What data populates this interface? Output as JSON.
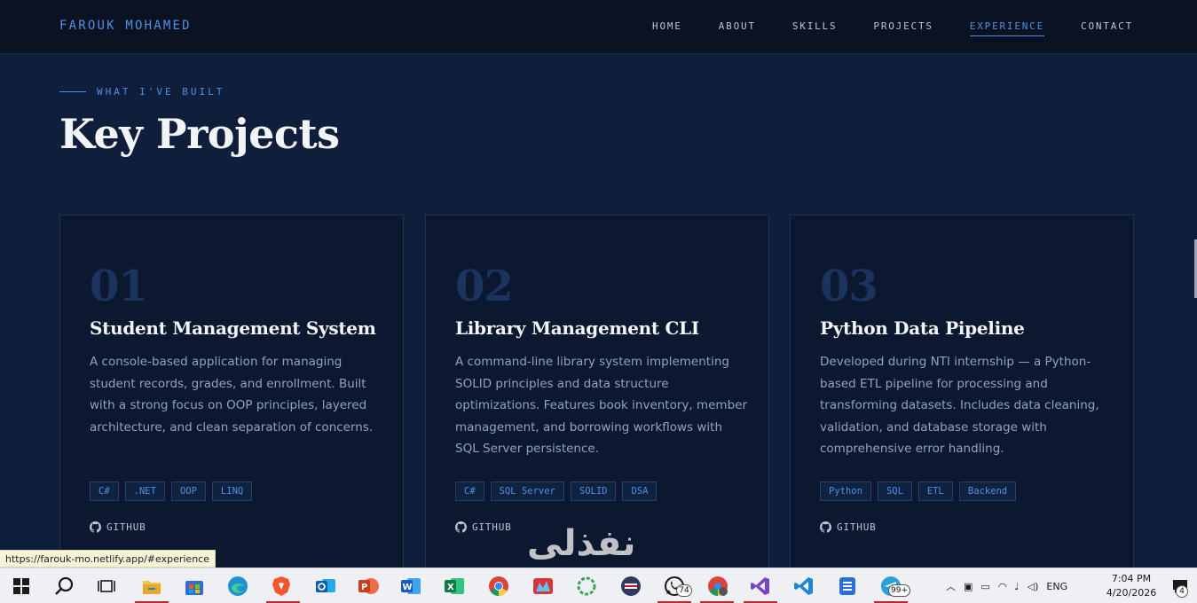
{
  "nav": {
    "brand": "FAROUK MOHAMED",
    "links": [
      {
        "label": "HOME"
      },
      {
        "label": "ABOUT"
      },
      {
        "label": "SKILLS"
      },
      {
        "label": "PROJECTS"
      },
      {
        "label": "EXPERIENCE"
      },
      {
        "label": "CONTACT"
      }
    ],
    "active": "EXPERIENCE"
  },
  "section": {
    "eyebrow": "WHAT I'VE BUILT",
    "title": "Key Projects"
  },
  "projects": [
    {
      "number": "01",
      "title": "Student Management System",
      "description": "A console-based application for managing student records, grades, and enrollment. Built with a strong focus on OOP principles, layered architecture, and clean separation of concerns.",
      "tags": [
        "C#",
        ".NET",
        "OOP",
        "LINQ"
      ],
      "link_label": "GITHUB"
    },
    {
      "number": "02",
      "title": "Library Management CLI",
      "description": "A command-line library system implementing SOLID principles and data structure optimizations. Features book inventory, member management, and borrowing workflows with SQL Server persistence.",
      "tags": [
        "C#",
        "SQL Server",
        "SOLID",
        "DSA"
      ],
      "link_label": "GITHUB"
    },
    {
      "number": "03",
      "title": "Python Data Pipeline",
      "description": "Developed during NTI internship — a Python-based ETL pipeline for processing and transforming datasets. Includes data cleaning, validation, and database storage with comprehensive error handling.",
      "tags": [
        "Python",
        "SQL",
        "ETL",
        "Backend"
      ],
      "link_label": "GITHUB"
    }
  ],
  "status_url": "https://farouk-mo.netlify.app/#experience",
  "watermark": "نفذلى",
  "taskbar": {
    "apps": [
      {
        "icon": "file-explorer-icon"
      },
      {
        "icon": "microsoft-store-icon"
      },
      {
        "icon": "edge-icon"
      },
      {
        "icon": "brave-icon"
      },
      {
        "icon": "outlook-icon"
      },
      {
        "icon": "powerpoint-icon"
      },
      {
        "icon": "word-icon"
      },
      {
        "icon": "excel-icon"
      },
      {
        "icon": "chrome-icon"
      },
      {
        "icon": "app-icon"
      },
      {
        "icon": "sync-icon"
      },
      {
        "icon": "vpn-icon"
      },
      {
        "icon": "whatsapp-icon",
        "badge": "74"
      },
      {
        "icon": "chrome-profile-icon"
      },
      {
        "icon": "visual-studio-icon"
      },
      {
        "icon": "vscode-icon"
      },
      {
        "icon": "app-blue-icon"
      },
      {
        "icon": "telegram-icon",
        "badge": "99+"
      }
    ],
    "language": "ENG",
    "time": "7:04 PM",
    "date": "4/20/2026",
    "notification_count": "4"
  },
  "colors": {
    "accent": "#4f8fe6",
    "background": "#0f1e3a",
    "card": "#0b1830"
  }
}
